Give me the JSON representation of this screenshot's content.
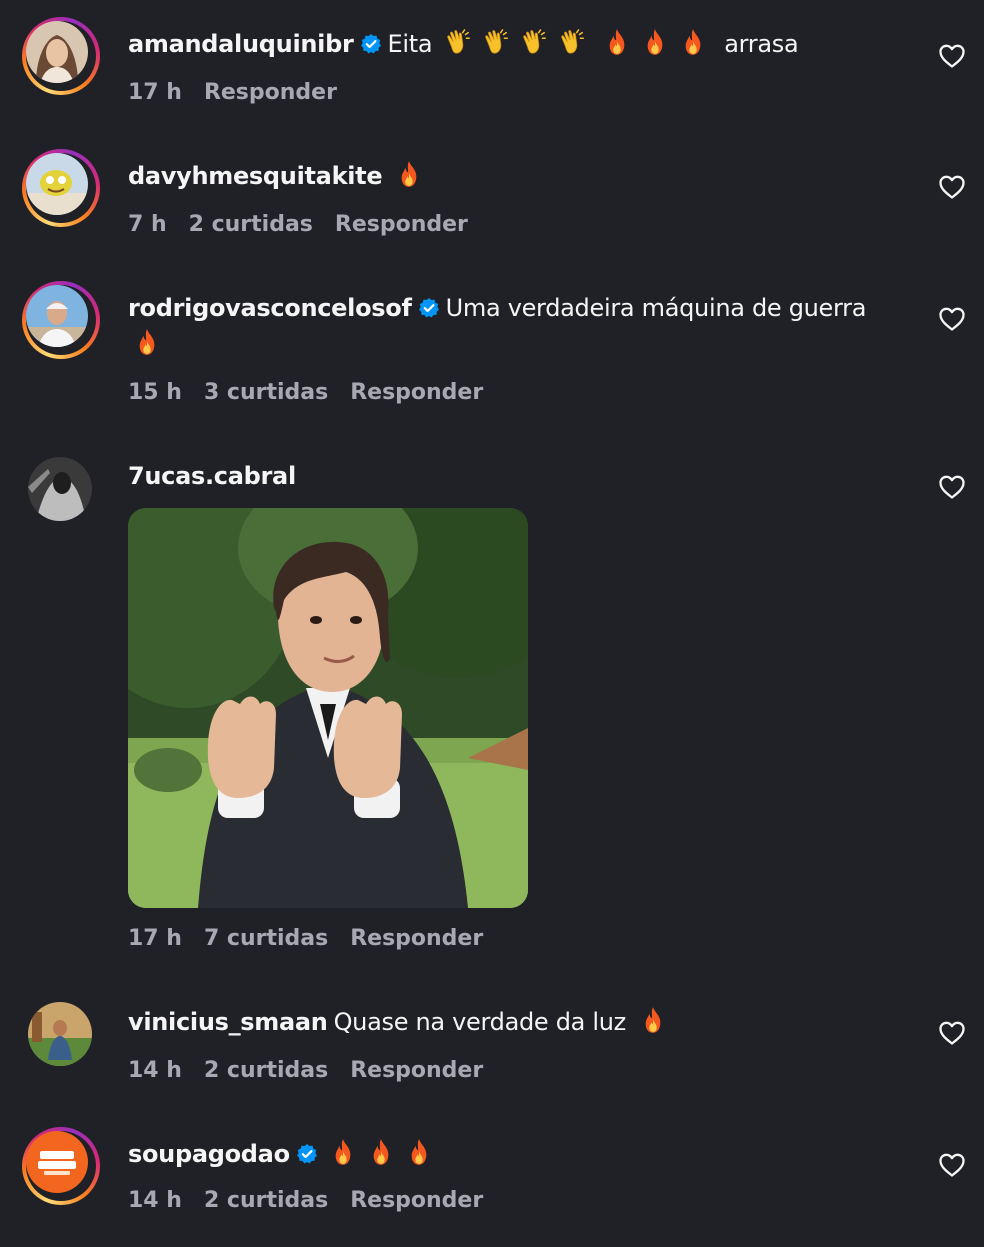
{
  "comments": [
    {
      "username": "amandaluquinibr",
      "verified": true,
      "text_before": "Eita",
      "text_after": "arrasa",
      "emoji_groups": [
        "clap x4",
        "fire x3"
      ],
      "time": "17 h",
      "likes": "",
      "reply": "Responder"
    },
    {
      "username": "davyhmesquitakite",
      "verified": false,
      "text": "",
      "emoji_groups": [
        "fire x1"
      ],
      "time": "7 h",
      "likes": "2 curtidas",
      "reply": "Responder"
    },
    {
      "username": "rodrigovasconcelosof",
      "verified": true,
      "text": "Uma verdadeira máquina de guerra",
      "emoji_groups": [
        "fire x1"
      ],
      "time": "15 h",
      "likes": "3 curtidas",
      "reply": "Responder"
    },
    {
      "username": "7ucas.cabral",
      "verified": false,
      "text": "",
      "attachment": "gif",
      "time": "17 h",
      "likes": "7 curtidas",
      "reply": "Responder"
    },
    {
      "username": "vinicius_smaan",
      "verified": false,
      "text": "Quase na verdade da luz",
      "emoji_groups": [
        "fire x1"
      ],
      "time": "14 h",
      "likes": "2 curtidas",
      "reply": "Responder"
    },
    {
      "username": "soupagodao",
      "verified": true,
      "text": "",
      "emoji_groups": [
        "fire x3"
      ],
      "time": "14 h",
      "likes": "2 curtidas",
      "reply": "Responder"
    }
  ],
  "colors": {
    "background": "#202127",
    "text": "#f5f5f5",
    "meta": "#a8a8b3",
    "verified": "#0095f6"
  },
  "icons": {
    "like": "heart-outline-icon",
    "verified": "verified-badge-icon",
    "fire": "fire-emoji",
    "clap": "clapping-hands-emoji"
  }
}
